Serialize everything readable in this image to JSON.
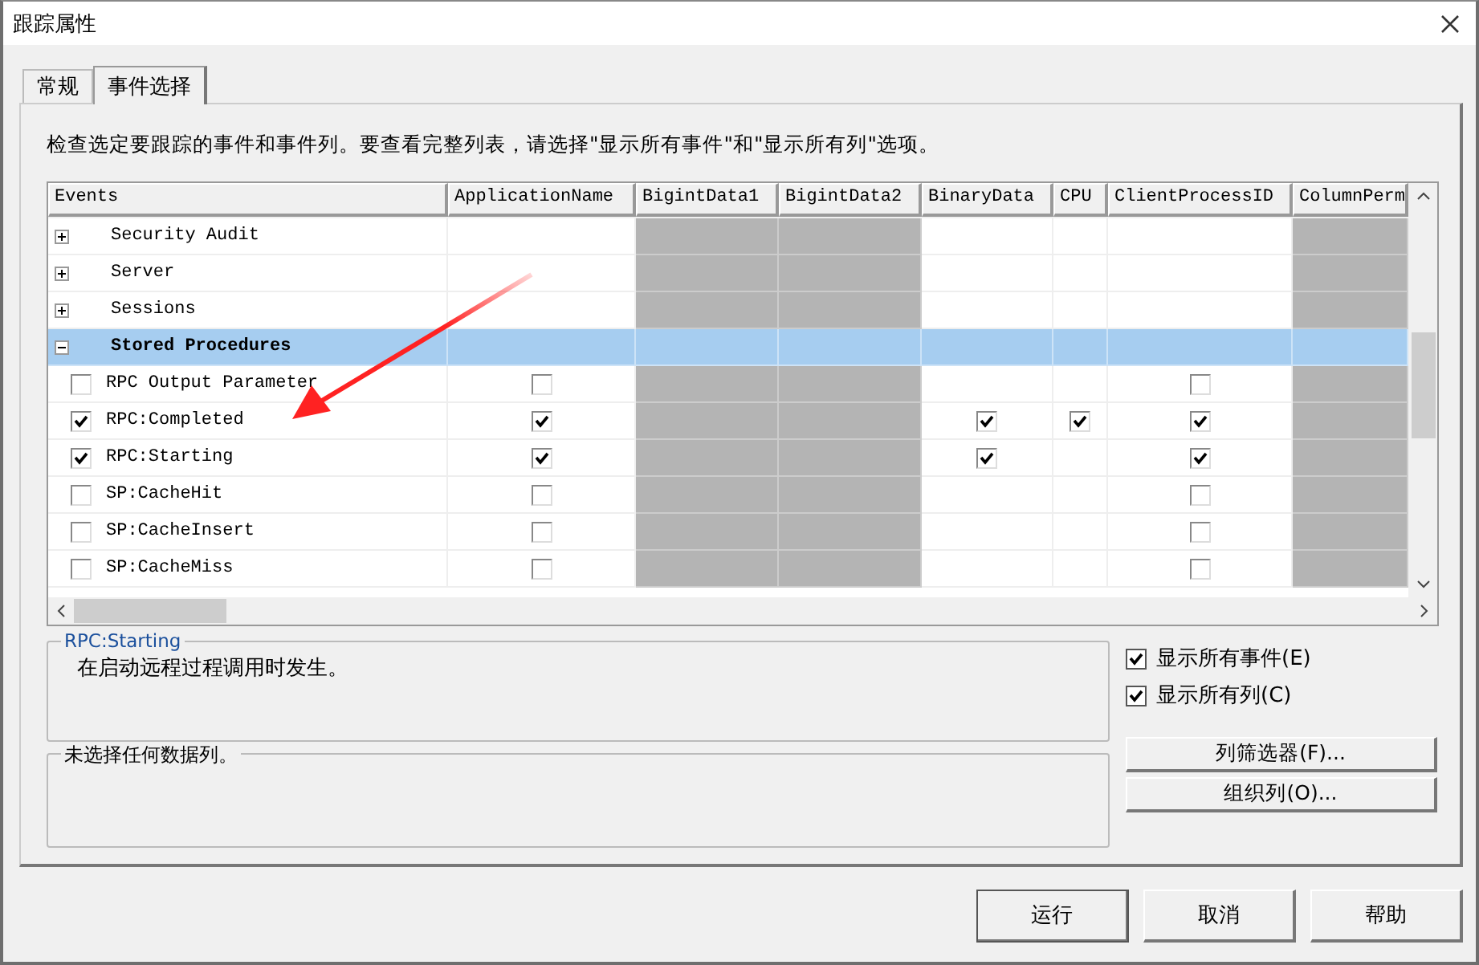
{
  "window": {
    "title": "跟踪属性"
  },
  "tabs": [
    {
      "label": "常规",
      "selected": false
    },
    {
      "label": "事件选择",
      "selected": true
    }
  ],
  "instruction": "检查选定要跟踪的事件和事件列。要查看完整列表，请选择\"显示所有事件\"和\"显示所有列\"选项。",
  "table": {
    "columns": [
      {
        "title": "Events",
        "available": true
      },
      {
        "title": "ApplicationName",
        "available": true
      },
      {
        "title": "BigintData1",
        "available": false
      },
      {
        "title": "BigintData2",
        "available": false
      },
      {
        "title": "BinaryData",
        "available": true
      },
      {
        "title": "CPU",
        "available": true
      },
      {
        "title": "ClientProcessID",
        "available": true
      },
      {
        "title": "ColumnPerm",
        "available": false
      }
    ],
    "rows": [
      {
        "kind": "category",
        "label": "Security Audit",
        "expanded": false,
        "selected": false
      },
      {
        "kind": "category",
        "label": "Server",
        "expanded": false,
        "selected": false
      },
      {
        "kind": "category",
        "label": "Sessions",
        "expanded": false,
        "selected": false
      },
      {
        "kind": "category",
        "label": "Stored Procedures",
        "expanded": true,
        "selected": true
      },
      {
        "kind": "event",
        "label": "RPC Output Parameter",
        "checked": false,
        "cells": [
          false,
          null,
          null,
          null,
          null,
          false,
          null
        ]
      },
      {
        "kind": "event",
        "label": "RPC:Completed",
        "checked": true,
        "cells": [
          true,
          null,
          null,
          true,
          true,
          true,
          null
        ]
      },
      {
        "kind": "event",
        "label": "RPC:Starting",
        "checked": true,
        "cells": [
          true,
          null,
          null,
          true,
          null,
          true,
          null
        ]
      },
      {
        "kind": "event",
        "label": "SP:CacheHit",
        "checked": false,
        "cells": [
          false,
          null,
          null,
          null,
          null,
          false,
          null
        ]
      },
      {
        "kind": "event",
        "label": "SP:CacheInsert",
        "checked": false,
        "cells": [
          false,
          null,
          null,
          null,
          null,
          false,
          null
        ]
      },
      {
        "kind": "event",
        "label": "SP:CacheMiss",
        "checked": false,
        "cells": [
          false,
          null,
          null,
          null,
          null,
          false,
          null
        ]
      }
    ]
  },
  "description": {
    "title": "RPC:Starting",
    "text": "在启动远程过程调用时发生。"
  },
  "columns_info": {
    "title": "未选择任何数据列。"
  },
  "options": [
    {
      "label": "显示所有事件(E)",
      "checked": true
    },
    {
      "label": "显示所有列(C)",
      "checked": true
    }
  ],
  "side_buttons": [
    "列筛选器(F)...",
    "组织列(O)..."
  ],
  "buttons": [
    "运行",
    "取消",
    "帮助"
  ]
}
